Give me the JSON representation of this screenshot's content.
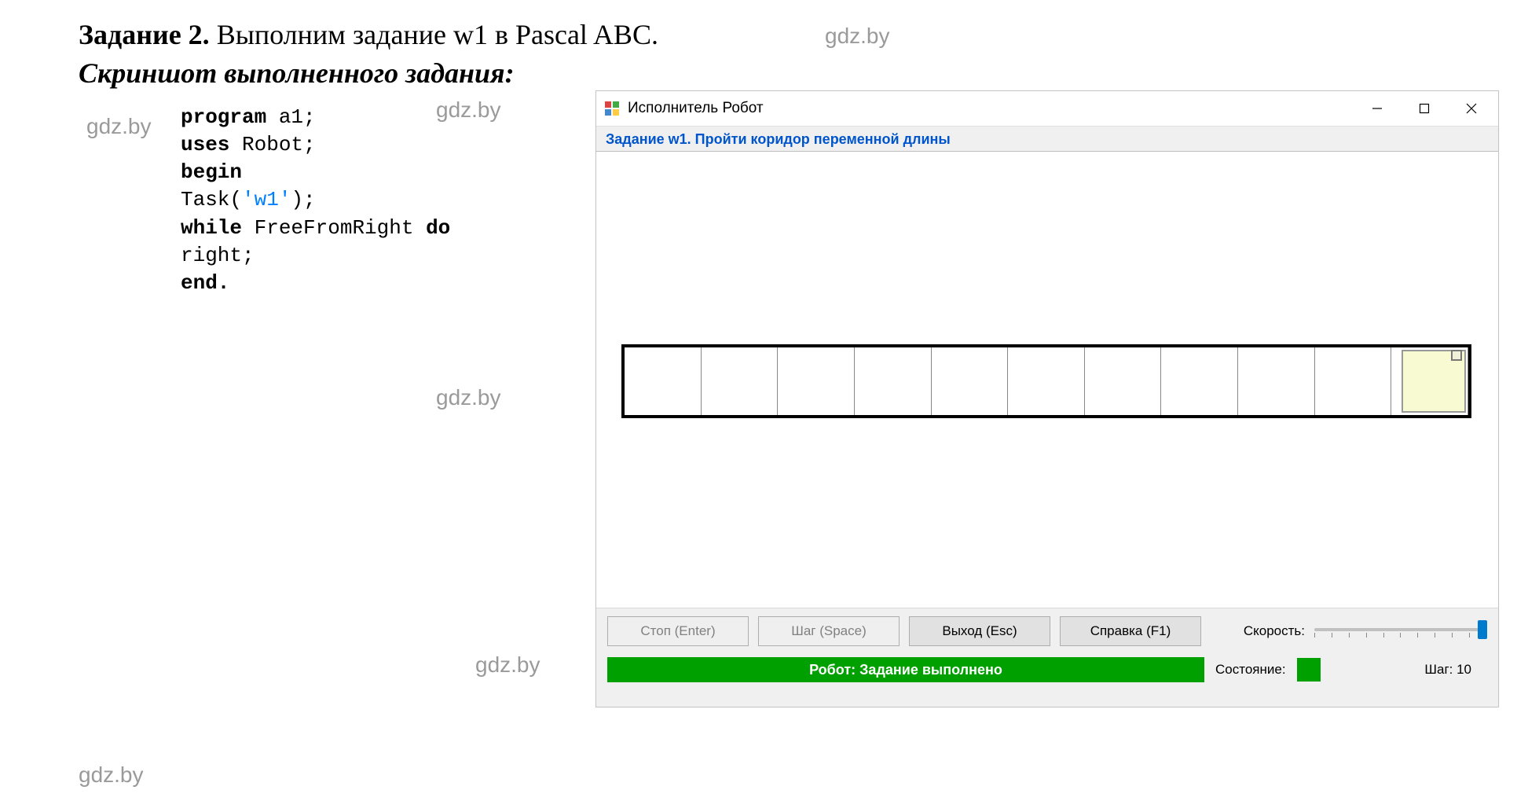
{
  "header": {
    "task_label": "Задание 2.",
    "task_text": "Выполним задание w1 в Pascal ABC.",
    "screenshot_label": "Скриншот выполненного задания:"
  },
  "watermarks": {
    "text": "gdz.by"
  },
  "code": {
    "l1a": "program",
    "l1b": " a1;",
    "l2a": "uses",
    "l2b": " Robot;",
    "l3": "begin",
    "l4a": "   Task(",
    "l4s": "'w1'",
    "l4b": ");",
    "l5a": "   while",
    "l5b": " FreeFromRight ",
    "l5c": "do",
    "l6": "   right;",
    "l7": "end."
  },
  "window": {
    "title": "Исполнитель Робот",
    "task_header": "Задание w1. Пройти коридор переменной длины"
  },
  "controls": {
    "stop": "Стоп (Enter)",
    "step": "Шаг (Space)",
    "exit": "Выход (Esc)",
    "help": "Справка (F1)",
    "speed_label": "Скорость:",
    "status_text": "Робот: Задание выполнено",
    "state_label": "Состояние:",
    "step_label": "Шаг: 10"
  },
  "corridor": {
    "cells": 11
  }
}
